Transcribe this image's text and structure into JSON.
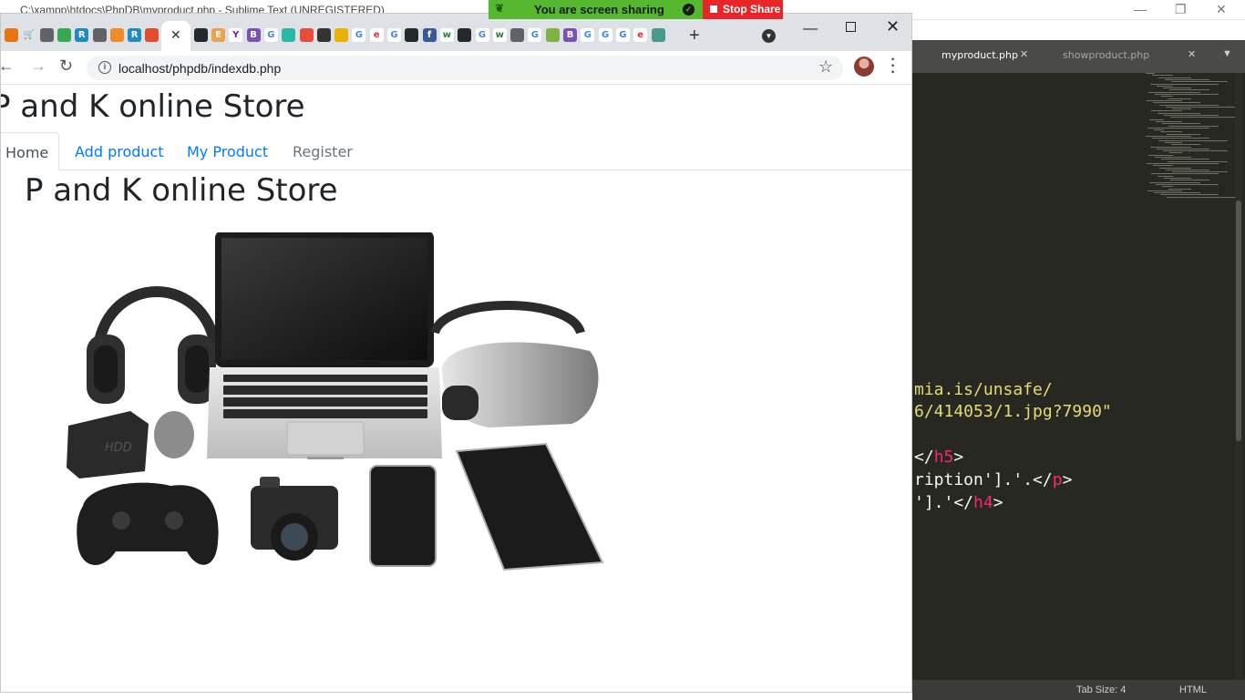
{
  "sublime": {
    "title": "C:\\xampp\\htdocs\\PhpDB\\myproduct.php - Sublime Text (UNREGISTERED)",
    "tabs": [
      {
        "label": "myproduct.php",
        "active": true
      },
      {
        "label": "showproduct.php",
        "active": false
      }
    ],
    "code_lines": [
      {
        "parts": [
          {
            "t": "mia.is/unsafe/",
            "c": "str"
          }
        ]
      },
      {
        "parts": [
          {
            "t": "6/414053/1.jpg?7990\"",
            "c": "str"
          }
        ]
      },
      {
        "parts": [
          {
            "t": "</",
            "c": "plain"
          },
          {
            "t": "h5",
            "c": "tag"
          },
          {
            "t": ">",
            "c": "plain"
          }
        ]
      },
      {
        "parts": [
          {
            "t": "ription'].'.</",
            "c": "plain"
          },
          {
            "t": "p",
            "c": "tag"
          },
          {
            "t": ">",
            "c": "plain"
          }
        ]
      },
      {
        "parts": [
          {
            "t": "'].'</",
            "c": "plain"
          },
          {
            "t": "h4",
            "c": "tag"
          },
          {
            "t": ">",
            "c": "plain"
          }
        ]
      }
    ],
    "status_tab_size": "Tab Size: 4",
    "status_syntax": "HTML"
  },
  "screen_share": {
    "message": "You are screen sharing",
    "stop_label": "Stop Share",
    "bar_color": "#55b82f",
    "stop_color": "#e8262a"
  },
  "browser": {
    "url": "localhost/phpdb/indexdb.php",
    "favicons": [
      {
        "name": "sublime-favicon",
        "glyph": "",
        "color": "#e8760f"
      },
      {
        "name": "cart-favicon",
        "glyph": "🛒",
        "color": "#dee1e6"
      },
      {
        "name": "globe-favicon",
        "glyph": "",
        "color": "#5f6368"
      },
      {
        "name": "drive-favicon",
        "glyph": "",
        "color": "#34a853"
      },
      {
        "name": "rstudio-favicon",
        "glyph": "R",
        "color": "#1e8bc3"
      },
      {
        "name": "globe-favicon",
        "glyph": "",
        "color": "#5f6368"
      },
      {
        "name": "fox-favicon",
        "glyph": "",
        "color": "#f28c28"
      },
      {
        "name": "rstudio-favicon",
        "glyph": "R",
        "color": "#1e8bc3"
      },
      {
        "name": "git-favicon",
        "glyph": "",
        "color": "#e44c30"
      },
      {
        "name": "github-favicon",
        "glyph": "",
        "color": "#24292e"
      },
      {
        "name": "e-favicon",
        "glyph": "E",
        "color": "#f0a048"
      },
      {
        "name": "y-favicon",
        "glyph": "Y",
        "color": "#ffffff"
      },
      {
        "name": "bootstrap-favicon",
        "glyph": "B",
        "color": "#7952b3"
      },
      {
        "name": "google-favicon",
        "glyph": "G",
        "color": "#ffffff"
      },
      {
        "name": "diamond-favicon",
        "glyph": "",
        "color": "#2bb7a5"
      },
      {
        "name": "c-favicon",
        "glyph": "",
        "color": "#e74c3c"
      },
      {
        "name": "photo-favicon",
        "glyph": "",
        "color": "#333333"
      },
      {
        "name": "color-favicon",
        "glyph": "",
        "color": "#e9b100"
      },
      {
        "name": "google-favicon",
        "glyph": "G",
        "color": "#ffffff"
      },
      {
        "name": "edureka-favicon",
        "glyph": "e",
        "color": "#ffffff"
      },
      {
        "name": "google-favicon",
        "glyph": "G",
        "color": "#ffffff"
      },
      {
        "name": "github-favicon",
        "glyph": "",
        "color": "#24292e"
      },
      {
        "name": "facebook-favicon",
        "glyph": "f",
        "color": "#3b5998"
      },
      {
        "name": "w-favicon",
        "glyph": "w",
        "color": "#ffffff"
      },
      {
        "name": "github-favicon",
        "glyph": "",
        "color": "#24292e"
      },
      {
        "name": "google-favicon",
        "glyph": "G",
        "color": "#ffffff"
      },
      {
        "name": "w-favicon",
        "glyph": "w",
        "color": "#ffffff"
      },
      {
        "name": "globe-favicon",
        "glyph": "",
        "color": "#5f6368"
      },
      {
        "name": "google-favicon",
        "glyph": "G",
        "color": "#ffffff"
      },
      {
        "name": "download-favicon",
        "glyph": "",
        "color": "#7cb342"
      },
      {
        "name": "bootstrap-favicon",
        "glyph": "B",
        "color": "#7952b3"
      },
      {
        "name": "google-favicon",
        "glyph": "G",
        "color": "#ffffff"
      },
      {
        "name": "google-favicon",
        "glyph": "G",
        "color": "#ffffff"
      },
      {
        "name": "google-favicon",
        "glyph": "G",
        "color": "#ffffff"
      },
      {
        "name": "edureka-favicon",
        "glyph": "e",
        "color": "#ffffff"
      },
      {
        "name": "tea-favicon",
        "glyph": "",
        "color": "#4a9a8a"
      }
    ]
  },
  "page": {
    "site_title": "P and K online Store",
    "nav": [
      {
        "label": "Home",
        "state": "active"
      },
      {
        "label": "Add product",
        "state": "link"
      },
      {
        "label": "My Product",
        "state": "link"
      },
      {
        "label": "Register",
        "state": "muted"
      }
    ],
    "heading": "P and K online Store",
    "image_alt": "Electronic devices: headphones, laptop, VR headset, hard drive, mouse, game controller, camera, smartphone, tablet"
  }
}
